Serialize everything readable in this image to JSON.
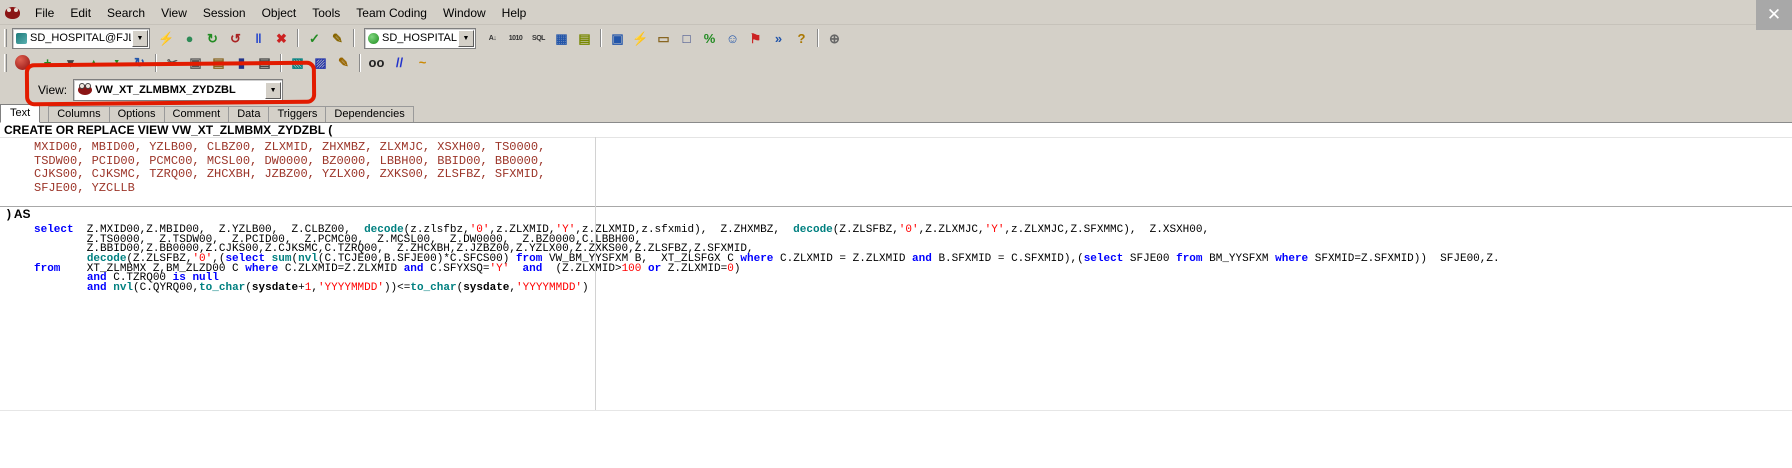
{
  "window": {
    "close_label": "✕"
  },
  "menubar": {
    "items": [
      "File",
      "Edit",
      "Search",
      "View",
      "Session",
      "Object",
      "Tools",
      "Team Coding",
      "Window",
      "Help"
    ]
  },
  "toolbar_main": {
    "connection_combo": "SD_HOSPITAL@FJLNYY(",
    "schema_combo": "SD_HOSPITAL",
    "buttons_left": [
      {
        "n": "new-connection-icon",
        "g": "⚡",
        "c": "#cc8800"
      },
      {
        "n": "globe-icon",
        "g": "●",
        "c": "#2e8b57"
      },
      {
        "n": "commit-icon",
        "g": "↻",
        "c": "#228b22"
      },
      {
        "n": "rollback-icon",
        "g": "↺",
        "c": "#aa2222"
      },
      {
        "n": "pause-icon",
        "g": "‖",
        "c": "#2244cc"
      },
      {
        "n": "stop-icon",
        "g": "✖",
        "c": "#cc2222"
      },
      "sep",
      {
        "n": "describe-icon",
        "g": "✓",
        "c": "#228b22"
      },
      {
        "n": "filter-edit-icon",
        "g": "✎",
        "c": "#886600"
      },
      "sep"
    ],
    "buttons_right": [
      {
        "n": "sort-az-icon",
        "g": "A↓",
        "c": "#333333",
        "small": true
      },
      {
        "n": "calculator-1010-icon",
        "g": "1010",
        "c": "#333333",
        "small": true
      },
      {
        "n": "sql-pencil-icon",
        "g": "SQL",
        "c": "#333333",
        "small": true
      },
      {
        "n": "grid-icon",
        "g": "▦",
        "c": "#2255aa"
      },
      {
        "n": "report-icon",
        "g": "▤",
        "c": "#778800"
      },
      "sep",
      {
        "n": "schema-browser-icon",
        "g": "▣",
        "c": "#2255aa"
      },
      {
        "n": "sql-editor-icon",
        "g": "⚡",
        "c": "#cc8800"
      },
      {
        "n": "open-file-icon",
        "g": "▭",
        "c": "#886622"
      },
      {
        "n": "session-windows-icon",
        "g": "□",
        "c": "#334488"
      },
      {
        "n": "percent-icon",
        "g": "%",
        "c": "#228b22"
      },
      {
        "n": "team-coding-icon",
        "g": "☺",
        "c": "#2255aa"
      },
      {
        "n": "flags-icon",
        "g": "⚑",
        "c": "#cc2222"
      },
      {
        "n": "next-window-icon",
        "g": "»",
        "c": "#2255aa"
      },
      {
        "n": "help-icon",
        "g": "?",
        "c": "#aa7700"
      },
      "sep",
      {
        "n": "gear-icon",
        "g": "⊕",
        "c": "#666666"
      }
    ]
  },
  "toolbar_edit": {
    "buttons": [
      {
        "n": "add-icon",
        "g": "+",
        "c": "#228b22"
      },
      {
        "n": "dropdown-icon",
        "g": "▾",
        "c": "#444444"
      },
      {
        "n": "promote-icon",
        "g": "▲",
        "c": "#228b22",
        "small": true
      },
      {
        "n": "demote-icon",
        "g": "▼",
        "c": "#228b22",
        "small": true
      },
      {
        "n": "refresh-icon",
        "g": "↻",
        "c": "#2255aa"
      },
      "sep",
      {
        "n": "cut-icon",
        "g": "✂",
        "c": "#555555"
      },
      {
        "n": "copy-icon",
        "g": "▣",
        "c": "#555555"
      },
      {
        "n": "paste-icon",
        "g": "▤",
        "c": "#886622"
      },
      {
        "n": "save-icon",
        "g": "▮",
        "c": "#223388"
      },
      {
        "n": "print-icon",
        "g": "▤",
        "c": "#444444"
      },
      "sep",
      {
        "n": "load-from-file-icon",
        "g": "▧",
        "c": "#008080"
      },
      {
        "n": "save-to-file-icon",
        "g": "▨",
        "c": "#2233aa"
      },
      {
        "n": "edit-pencil-icon",
        "g": "✎",
        "c": "#996600"
      },
      "sep",
      {
        "n": "find-binoculars-icon",
        "g": "oo",
        "c": "#222222",
        "small": false
      },
      {
        "n": "comment-icon",
        "g": "//",
        "c": "#2233cc"
      },
      {
        "n": "format-code-icon",
        "g": "~",
        "c": "#cc8800"
      }
    ]
  },
  "view_selector": {
    "label": "View:",
    "value": "VW_XT_ZLMBMX_ZYDZBL"
  },
  "tabs": {
    "items": [
      {
        "label": "Text",
        "selected": true
      },
      {
        "label": "Columns",
        "selected": false
      },
      {
        "label": "Options",
        "selected": false
      },
      {
        "label": "Comment",
        "selected": false
      },
      {
        "label": "Data",
        "selected": false
      },
      {
        "label": "Triggers",
        "selected": false
      },
      {
        "label": "Dependencies",
        "selected": false
      }
    ]
  },
  "editor": {
    "header": "CREATE OR REPLACE VIEW VW_XT_ZLMBMX_ZYDZBL (",
    "columns_lines": [
      "MXID00, MBID00, YZLB00, CLBZ00, ZLXMID, ZHXMBZ, ZLXMJC, XSXH00, TS0000,",
      "TSDW00, PCID00, PCMC00, MCSL00, DW0000, BZ0000, LBBH00, BBID00, BB0000,",
      "CJKS00, CJKSMC, TZRQ00, ZHCXBH, JZBZ00, YZLX00, ZXKS00, ZLSFBZ, SFXMID,",
      "SFJE00, YZCLLB"
    ],
    "as_line": ") AS",
    "sql_lines": [
      [
        [
          "kw",
          "select"
        ],
        [
          "id",
          "  Z.MXID00,Z.MBID00,  Z.YZLB00,  Z.CLBZ00,  "
        ],
        [
          "fn",
          "decode"
        ],
        [
          "id",
          "(z.zlsfbz,"
        ],
        [
          "str",
          "'0'"
        ],
        [
          "id",
          ",z.ZLXMID,"
        ],
        [
          "str",
          "'Y'"
        ],
        [
          "id",
          ",z.ZLXMID,z.sfxmid),  Z.ZHXMBZ,  "
        ],
        [
          "fn",
          "decode"
        ],
        [
          "id",
          "(Z.ZLSFBZ,"
        ],
        [
          "str",
          "'0'"
        ],
        [
          "id",
          ",Z.ZLXMJC,"
        ],
        [
          "str",
          "'Y'"
        ],
        [
          "id",
          ",z.ZLXMJC,Z.SFXMMC),  Z.XSXH00,"
        ]
      ],
      [
        [
          "id",
          "        Z.TS0000,  Z.TSDW00,  Z.PCID00,  Z.PCMC00,  Z.MCSL00,  Z.DW0000,  Z.BZ0000,C.LBBH00,"
        ]
      ],
      [
        [
          "id",
          "        Z.BBID00,Z.BB0000,Z.CJKS00,Z.CJKSMC,C.TZRQ00,  Z.ZHCXBH,Z.JZBZ00,Z.YZLX00,Z.ZXKS00,Z.ZLSFBZ,Z.SFXMID,"
        ]
      ],
      [
        [
          "id",
          "        "
        ],
        [
          "fn",
          "decode"
        ],
        [
          "id",
          "(Z.ZLSFBZ,"
        ],
        [
          "str",
          "'0'"
        ],
        [
          "id",
          ",("
        ],
        [
          "kw",
          "select"
        ],
        [
          "id",
          " "
        ],
        [
          "fn",
          "sum"
        ],
        [
          "id",
          "("
        ],
        [
          "fn",
          "nvl"
        ],
        [
          "id",
          "(C.TCJE00,B.SFJE00)*C.SFCS00) "
        ],
        [
          "kw",
          "from"
        ],
        [
          "id",
          " VW_BM_YYSFXM B,  XT_ZLSFGX C "
        ],
        [
          "kw",
          "where"
        ],
        [
          "id",
          " C.ZLXMID = Z.ZLXMID "
        ],
        [
          "kw",
          "and"
        ],
        [
          "id",
          " B.SFXMID = C.SFXMID),("
        ],
        [
          "kw",
          "select"
        ],
        [
          "id",
          " SFJE00 "
        ],
        [
          "kw",
          "from"
        ],
        [
          "id",
          " BM_YYSFXM "
        ],
        [
          "kw",
          "where"
        ],
        [
          "id",
          " SFXMID=Z.SFXMID))  SFJE00,Z."
        ]
      ],
      [
        [
          "kw",
          "from"
        ],
        [
          "id",
          "    XT_ZLMBMX Z,BM_ZLZD00 C "
        ],
        [
          "kw",
          "where"
        ],
        [
          "id",
          " C.ZLXMID=Z.ZLXMID "
        ],
        [
          "kw",
          "and"
        ],
        [
          "id",
          " C.SFYXSQ="
        ],
        [
          "str",
          "'Y'"
        ],
        [
          "id",
          "  "
        ],
        [
          "kw",
          "and"
        ],
        [
          "id",
          "  (Z.ZLXMID>"
        ],
        [
          "num",
          "100"
        ],
        [
          "id",
          " "
        ],
        [
          "kw",
          "or"
        ],
        [
          "id",
          " Z.ZLXMID="
        ],
        [
          "num",
          "0"
        ],
        [
          "id",
          ")"
        ]
      ],
      [
        [
          "id",
          "        "
        ],
        [
          "kw",
          "and"
        ],
        [
          "id",
          " C.TZRQ00 "
        ],
        [
          "kw",
          "is null"
        ]
      ],
      [
        [
          "id",
          "        "
        ],
        [
          "kw",
          "and"
        ],
        [
          "id",
          " "
        ],
        [
          "fn",
          "nvl"
        ],
        [
          "id",
          "(C.QYRQ00,"
        ],
        [
          "fn",
          "to_char"
        ],
        [
          "id",
          "("
        ],
        [
          "sys",
          "sysdate"
        ],
        [
          "id",
          "+"
        ],
        [
          "num",
          "1"
        ],
        [
          "id",
          ","
        ],
        [
          "str",
          "'YYYYMMDD'"
        ],
        [
          "id",
          "))<="
        ],
        [
          "fn",
          "to_char"
        ],
        [
          "id",
          "("
        ],
        [
          "sys",
          "sysdate"
        ],
        [
          "id",
          ","
        ],
        [
          "str",
          "'YYYYMMDD'"
        ],
        [
          "id",
          ")"
        ]
      ]
    ]
  },
  "colors": {
    "annotation_red": "#e21b00",
    "keyword_blue": "#0000ff",
    "function_teal": "#008080",
    "string_red": "#ff0000",
    "columns_maroon": "#9c3529",
    "chrome_gray": "#d4d0c8"
  }
}
